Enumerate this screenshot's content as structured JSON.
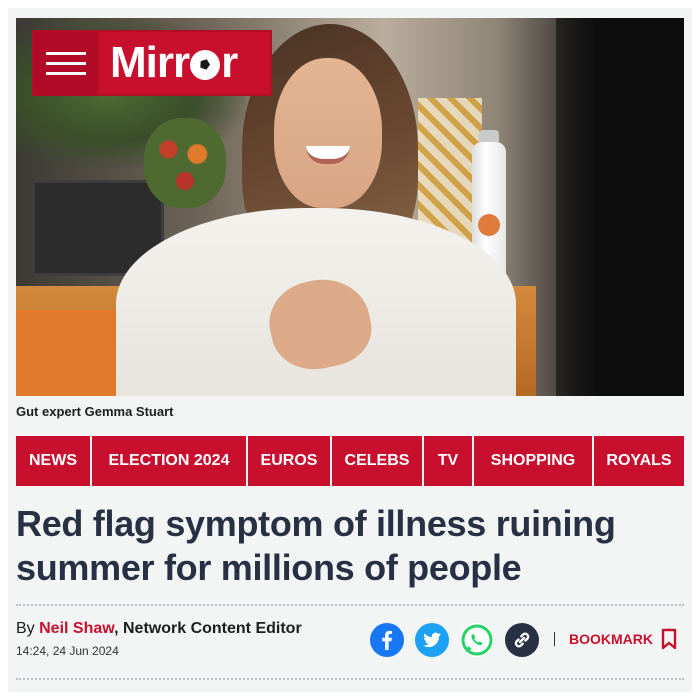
{
  "brand": {
    "name": "Mirror",
    "prefix": "Mirr",
    "suffix": "r",
    "color": "#c8102e",
    "menu_icon": "hamburger-menu-icon"
  },
  "hero": {
    "caption": "Gut expert Gemma Stuart"
  },
  "nav": {
    "items": [
      {
        "label": "NEWS"
      },
      {
        "label": "ELECTION 2024"
      },
      {
        "label": "EUROS"
      },
      {
        "label": "CELEBS"
      },
      {
        "label": "TV"
      },
      {
        "label": "SHOPPING"
      },
      {
        "label": "ROYALS"
      }
    ]
  },
  "article": {
    "headline": "Red flag symptom of illness ruining summer for millions of people",
    "byline_prefix": "By ",
    "author": "Neil Shaw",
    "role": ", Network Content Editor",
    "date": "14:24, 24 Jun 2024"
  },
  "share": {
    "buttons": [
      {
        "icon": "facebook-icon",
        "color": "#1877f2"
      },
      {
        "icon": "twitter-icon",
        "color": "#1da1f2"
      },
      {
        "icon": "whatsapp-icon",
        "color": "#25d366"
      },
      {
        "icon": "link-icon",
        "color": "#283044"
      }
    ],
    "bookmark_label": "BOOKMARK",
    "bookmark_icon": "bookmark-icon"
  }
}
